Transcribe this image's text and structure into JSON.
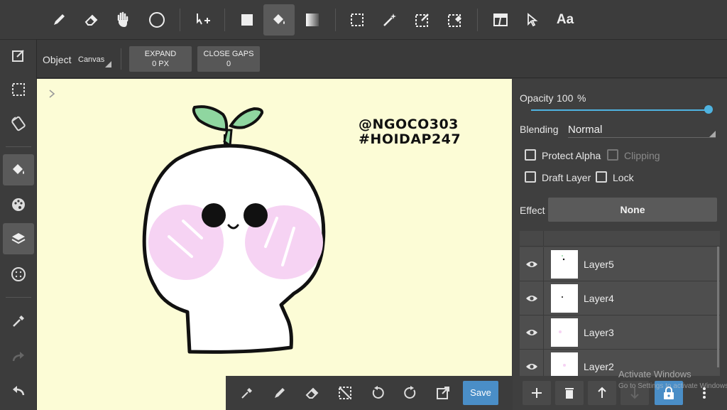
{
  "toolbar": {
    "tools": [
      "pen-icon",
      "eraser-icon",
      "hand-icon",
      "circle-icon",
      "move-icon",
      "fill-rect-icon",
      "bucket-icon",
      "gradient-icon",
      "select-rect-icon",
      "magic-wand-icon",
      "select-pen-icon",
      "select-eraser-icon",
      "layout-icon",
      "cursor-icon",
      "text-icon"
    ],
    "text_tool_label": "Aa",
    "active_tool": "bucket-icon"
  },
  "subtoolbar": {
    "object_label": "Object",
    "object_value": "Canvas",
    "expand_label": "EXPAND",
    "expand_value": "0 PX",
    "close_gaps_label": "CLOSE GAPS",
    "close_gaps_value": "0"
  },
  "leftbar": {
    "items": [
      "menu-icon",
      "edit-icon",
      "selection-icon",
      "rotate-icon",
      "bucket-icon",
      "palette-icon",
      "layers-icon",
      "dots-icon",
      "eyedropper-icon",
      "redo-icon",
      "undo-icon"
    ]
  },
  "canvas": {
    "watermark_line1": "@NGOCO303",
    "watermark_line2": "#HOIDAP247"
  },
  "layer_panel": {
    "opacity_label": "Opacity",
    "opacity_value": "100",
    "opacity_unit": "%",
    "opacity_fraction": 1.0,
    "blending_label": "Blending",
    "blending_value": "Normal",
    "protect_alpha_label": "Protect Alpha",
    "clipping_label": "Clipping",
    "draft_layer_label": "Draft Layer",
    "lock_label": "Lock",
    "effect_label": "Effect",
    "effect_value": "None",
    "layers": [
      {
        "name": "Layer5"
      },
      {
        "name": "Layer4"
      },
      {
        "name": "Layer3"
      },
      {
        "name": "Layer2"
      }
    ]
  },
  "bottombar": {
    "save_label": "Save"
  },
  "watermark_os": {
    "title": "Activate Windows",
    "subtitle": "Go to Settings to activate Windows."
  },
  "colors": {
    "accent": "#4a8ec7",
    "slider": "#4fb3e0",
    "canvas_bg": "#fcfcd6",
    "blush": "#f6d3f3",
    "sprout": "#8fd6a0"
  }
}
